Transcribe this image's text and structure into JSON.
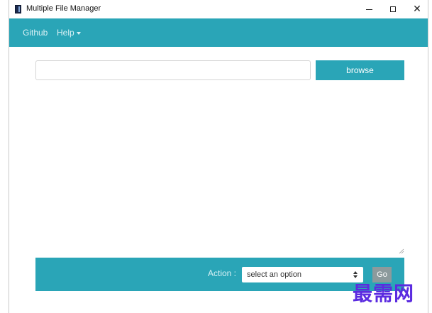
{
  "window": {
    "title": "Multiple File Manager",
    "close_glyph": "✕"
  },
  "navbar": {
    "links": [
      {
        "label": "Github"
      },
      {
        "label": "Help"
      }
    ]
  },
  "file_picker": {
    "path_value": "",
    "browse_label": "browse"
  },
  "action_bar": {
    "label": "Action :",
    "select_value": "select an option",
    "go_label": "Go"
  },
  "watermark": {
    "text": "最需网"
  },
  "colors": {
    "accent": "#2aa5b7",
    "nav_text": "#d9f1f5",
    "go_button": "#8c9a9c",
    "watermark": "#5b2be0"
  },
  "icons": {
    "app": "app-icon",
    "minimize": "minimize-icon",
    "maximize": "maximize-icon",
    "close": "close-icon",
    "dropdown": "caret-down-icon",
    "select": "sort-arrows-icon",
    "resize": "resize-grip-icon"
  }
}
